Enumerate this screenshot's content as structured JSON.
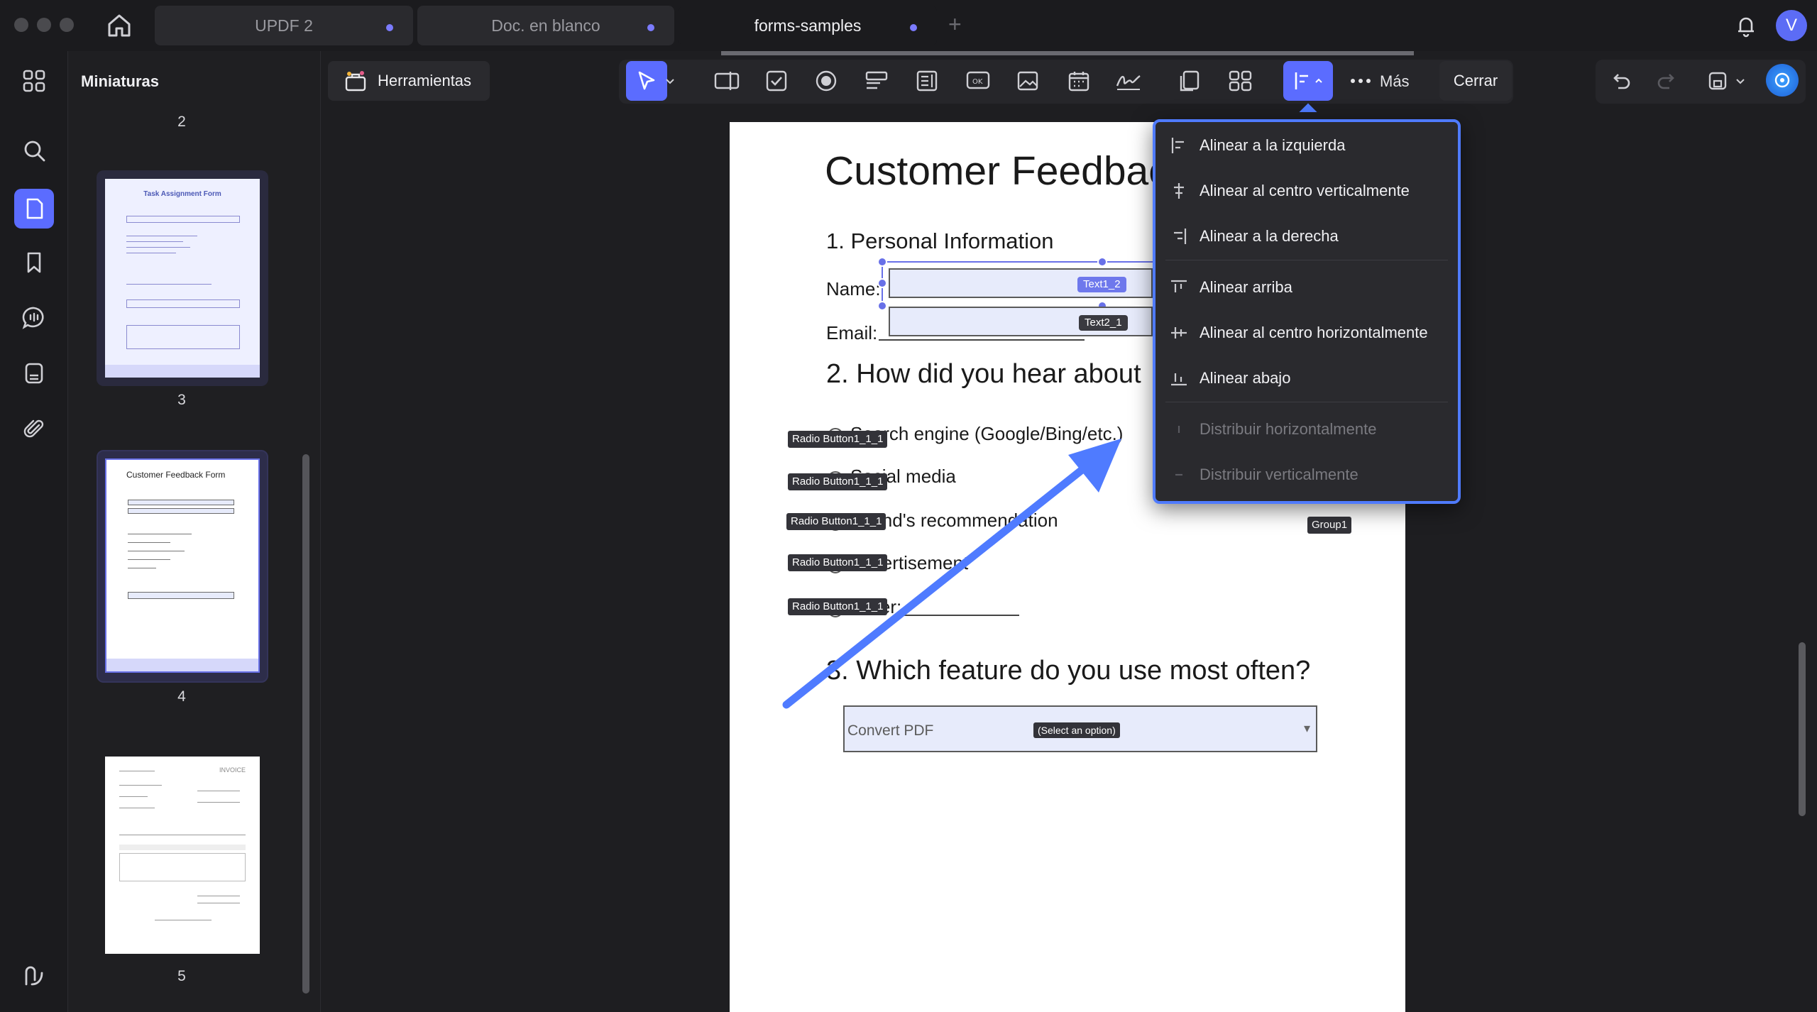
{
  "window": {
    "tabs": [
      {
        "label": "UPDF 2"
      },
      {
        "label": "Doc. en blanco"
      },
      {
        "label": "forms-samples"
      }
    ],
    "avatar_letter": "V"
  },
  "thumbnails": {
    "title": "Miniaturas",
    "pages": [
      "2",
      "3",
      "4",
      "5"
    ],
    "page3_heading": "Task Assignment Form",
    "page4_heading": "Customer Feedback Form",
    "page5_heading": "INVOICE"
  },
  "toolbar": {
    "tools_label": "Herramientas",
    "more_label": "Más",
    "close_label": "Cerrar"
  },
  "document": {
    "title": "Customer Feedbac",
    "section1": "1. Personal Information",
    "name_label": "Name:",
    "email_label": "Email:",
    "text_field_1": "Text1_2",
    "text_field_2": "Text2_1",
    "section2": "2. How did you hear about",
    "options": [
      {
        "text": "Search engine (Google/Bing/etc.)",
        "tag": "Radio Button1_1_1"
      },
      {
        "text": "Social media",
        "tag": "Radio Button1_1_1"
      },
      {
        "text": "Friend's recommendation",
        "tag": "Radio Button1_1_1"
      },
      {
        "text": "Advertisement",
        "tag": "Radio Button1_1_1"
      },
      {
        "text": "Other:",
        "tag": "Radio Button1_1_1"
      }
    ],
    "group_tag": "Group1",
    "section3": "3. Which feature do you use most often?",
    "dropdown_value": "Convert PDF",
    "dropdown_tag": "(Select an option)"
  },
  "align_menu": {
    "items": [
      {
        "label": "Alinear a la izquierda",
        "enabled": true
      },
      {
        "label": "Alinear al centro verticalmente",
        "enabled": true
      },
      {
        "label": "Alinear a la derecha",
        "enabled": true
      },
      {
        "label": "Alinear arriba",
        "enabled": true
      },
      {
        "label": "Alinear al centro horizontalmente",
        "enabled": true
      },
      {
        "label": "Alinear abajo",
        "enabled": true
      },
      {
        "label": "Distribuir horizontalmente",
        "enabled": false
      },
      {
        "label": "Distribuir verticalmente",
        "enabled": false
      }
    ]
  },
  "colors": {
    "accent": "#5b6cff",
    "menu_border": "#4f7bff",
    "annotation_arrow": "#4f7bff"
  }
}
